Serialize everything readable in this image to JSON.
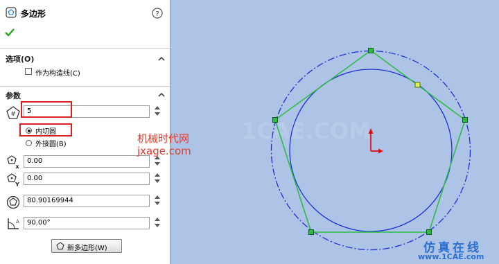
{
  "panel": {
    "title": "多边形",
    "help_icon": "help-icon",
    "confirm_icon": "check-icon"
  },
  "options": {
    "header": "选项(O)",
    "construction_label": "作为构造线(C)",
    "construction_checked": false
  },
  "params": {
    "header": "参数",
    "sides": "5",
    "radio_inscribed": "内切圆",
    "radio_circumscribed": "外接圆(B)",
    "selected": "内切圆",
    "center_x": "0.00",
    "center_y": "0.00",
    "diameter": "80.90169944",
    "angle": "90.00°",
    "new_polygon_button": "新多边形(W)"
  },
  "watermark": {
    "line1": "机械时代网",
    "line2": "jxage.com",
    "bottom": "仿真在线",
    "bottom_url": "www.1CAE.com",
    "center_logo": "1CAE.COM"
  },
  "colors": {
    "canvas_bg": "#aec4e6",
    "circle": "#1f2fd6",
    "polygon": "#2dbb46",
    "origin": "#e01010",
    "highlight": "#d62020"
  }
}
